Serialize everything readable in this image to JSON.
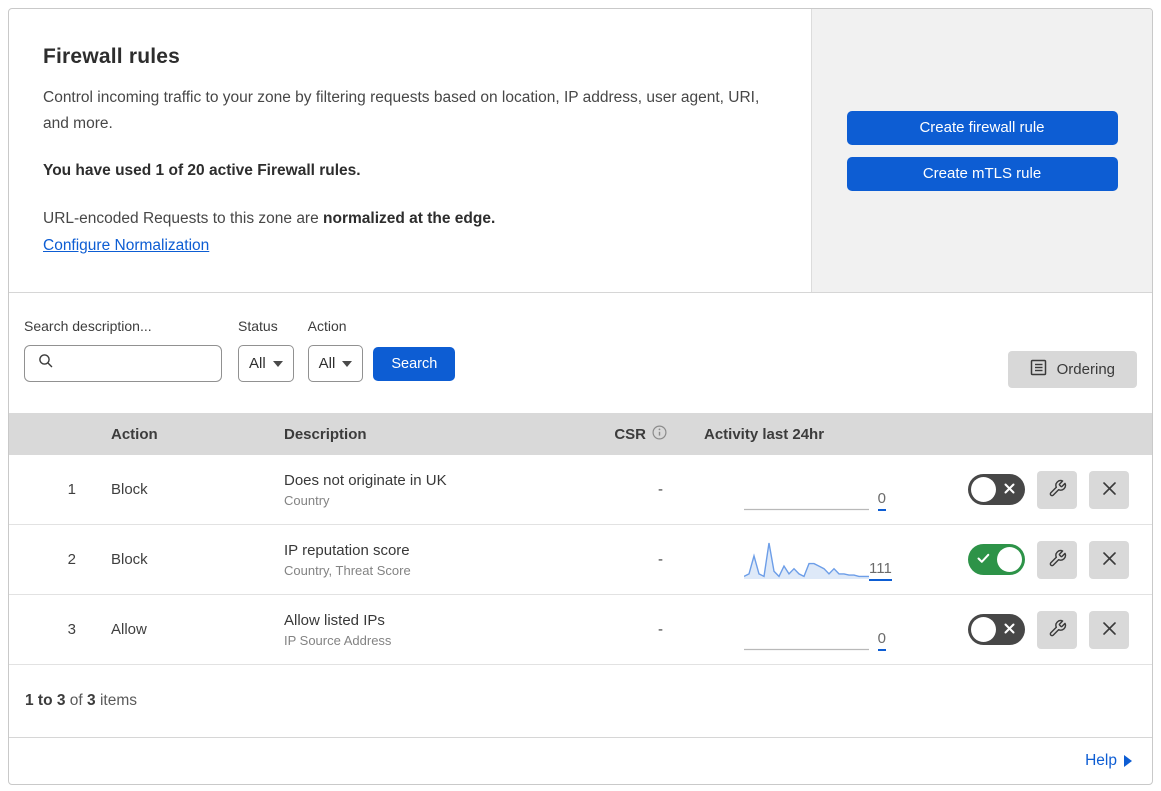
{
  "header": {
    "title": "Firewall rules",
    "description": "Control incoming traffic to your zone by filtering requests based on location, IP address, user agent, URI, and more.",
    "usage_text": "You have used 1 of 20 active Firewall rules.",
    "normalization_prefix": "URL-encoded Requests to this zone are ",
    "normalization_bold": "normalized at the edge.",
    "normalization_link": "Configure Normalization",
    "create_firewall_button": "Create firewall rule",
    "create_mtls_button": "Create mTLS rule"
  },
  "filters": {
    "search_label": "Search description...",
    "search_value": "",
    "status_label": "Status",
    "status_value": "All",
    "action_label": "Action",
    "action_value": "All",
    "search_button": "Search",
    "ordering_button": "Ordering"
  },
  "table": {
    "columns": [
      "Action",
      "Description",
      "CSR",
      "Activity last 24hr"
    ],
    "rows": [
      {
        "priority": "1",
        "action": "Block",
        "description": "Does not originate in UK",
        "match_fields": "Country",
        "csr": "-",
        "activity_count": "0",
        "enabled": false,
        "sparkline": [
          0,
          0,
          0,
          0,
          0,
          0,
          0,
          0,
          0,
          0,
          0,
          0,
          0,
          0,
          0,
          0,
          0,
          0,
          0,
          0,
          0,
          0,
          0,
          0,
          0,
          0
        ]
      },
      {
        "priority": "2",
        "action": "Block",
        "description": "IP reputation score",
        "match_fields": "Country, Threat Score",
        "csr": "-",
        "activity_count": "111",
        "enabled": true,
        "sparkline": [
          1,
          2,
          9,
          2,
          1,
          14,
          3,
          1,
          5,
          2,
          4,
          2,
          1,
          6,
          6,
          5,
          4,
          2,
          4,
          2,
          2,
          1.5,
          1.5,
          1,
          1,
          1
        ]
      },
      {
        "priority": "3",
        "action": "Allow",
        "description": "Allow listed IPs",
        "match_fields": "IP Source Address",
        "csr": "-",
        "activity_count": "0",
        "enabled": false,
        "sparkline": [
          0,
          0,
          0,
          0,
          0,
          0,
          0,
          0,
          0,
          0,
          0,
          0,
          0,
          0,
          0,
          0,
          0,
          0,
          0,
          0,
          0,
          0,
          0,
          0,
          0,
          0
        ]
      }
    ]
  },
  "footer": {
    "range_text": "1 to 3",
    "of_text": " of ",
    "total_text": "3",
    "items_text": " items",
    "help_label": "Help"
  },
  "icons": {
    "search": "magnifier",
    "csr_info": "info-circle",
    "ordering": "list-box",
    "edit": "wrench",
    "delete": "x",
    "toggle_on": "check",
    "toggle_off": "x",
    "help_arrow": "triangle-right"
  },
  "colors": {
    "primary_blue": "#0d5dd3",
    "toggle_on_green": "#2d9348",
    "toggle_off_gray": "#474747",
    "sparkline_line": "#6d9ee8",
    "sparkline_fill": "#c8daf4",
    "table_header_bg": "#d9d9d9",
    "panel_bg": "#f1f1f1"
  }
}
